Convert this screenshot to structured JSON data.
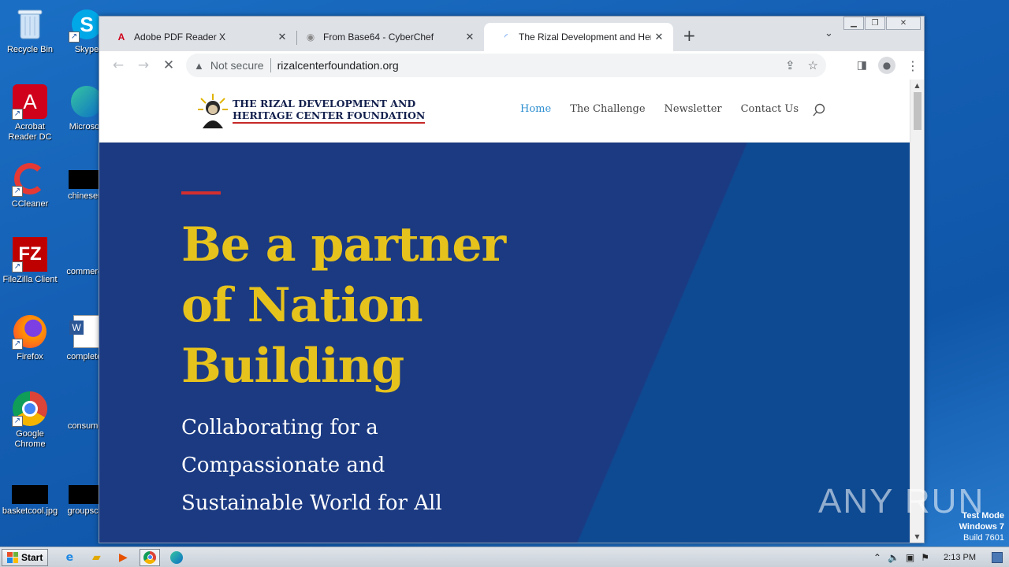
{
  "desktop": {
    "icons": [
      {
        "label": "Recycle Bin"
      },
      {
        "label": "Skype"
      },
      {
        "label": "Acrobat Reader DC"
      },
      {
        "label": "Microsoft"
      },
      {
        "label": "CCleaner"
      },
      {
        "label": "chineseur"
      },
      {
        "label": "FileZilla Client"
      },
      {
        "label": "commerce"
      },
      {
        "label": "Firefox"
      },
      {
        "label": "completen"
      },
      {
        "label": "Google Chrome"
      },
      {
        "label": "consumer"
      },
      {
        "label": "basketcool.jpg"
      },
      {
        "label": "groupscor"
      }
    ]
  },
  "browser": {
    "tabs": [
      {
        "title": "Adobe PDF Reader X",
        "icon": "adobe-pdf-icon"
      },
      {
        "title": "From Base64 - CyberChef",
        "icon": "cyberchef-icon"
      },
      {
        "title": "The Rizal Development and Heritage",
        "icon": "loading-spinner-icon"
      }
    ],
    "address": {
      "security_label": "Not secure",
      "url": "rizalcenterfoundation.org"
    }
  },
  "site": {
    "logo_line1": "THE RIZAL DEVELOPMENT AND",
    "logo_line2": "HERITAGE CENTER FOUNDATION",
    "nav": [
      {
        "label": "Home",
        "active": true
      },
      {
        "label": "The Challenge"
      },
      {
        "label": "Newsletter"
      },
      {
        "label": "Contact Us"
      }
    ],
    "hero": {
      "title_line1": "Be a partner",
      "title_line2": "of Nation",
      "title_line3": "Building",
      "sub_line1": "Collaborating for a",
      "sub_line2": "Compassionate and",
      "sub_line3": "Sustainable World for All"
    },
    "colors": {
      "hero_bg": "#1b3a82",
      "hero_title": "#e6c21c",
      "accent": "#d32f2f",
      "nav_active": "#2e8fd1"
    }
  },
  "watermark": {
    "text": "ANY RUN"
  },
  "os": {
    "testmode_line1": "Test Mode",
    "testmode_line2": "Windows 7",
    "testmode_line3": "Build 7601",
    "start_label": "Start",
    "clock": "2:13 PM"
  }
}
